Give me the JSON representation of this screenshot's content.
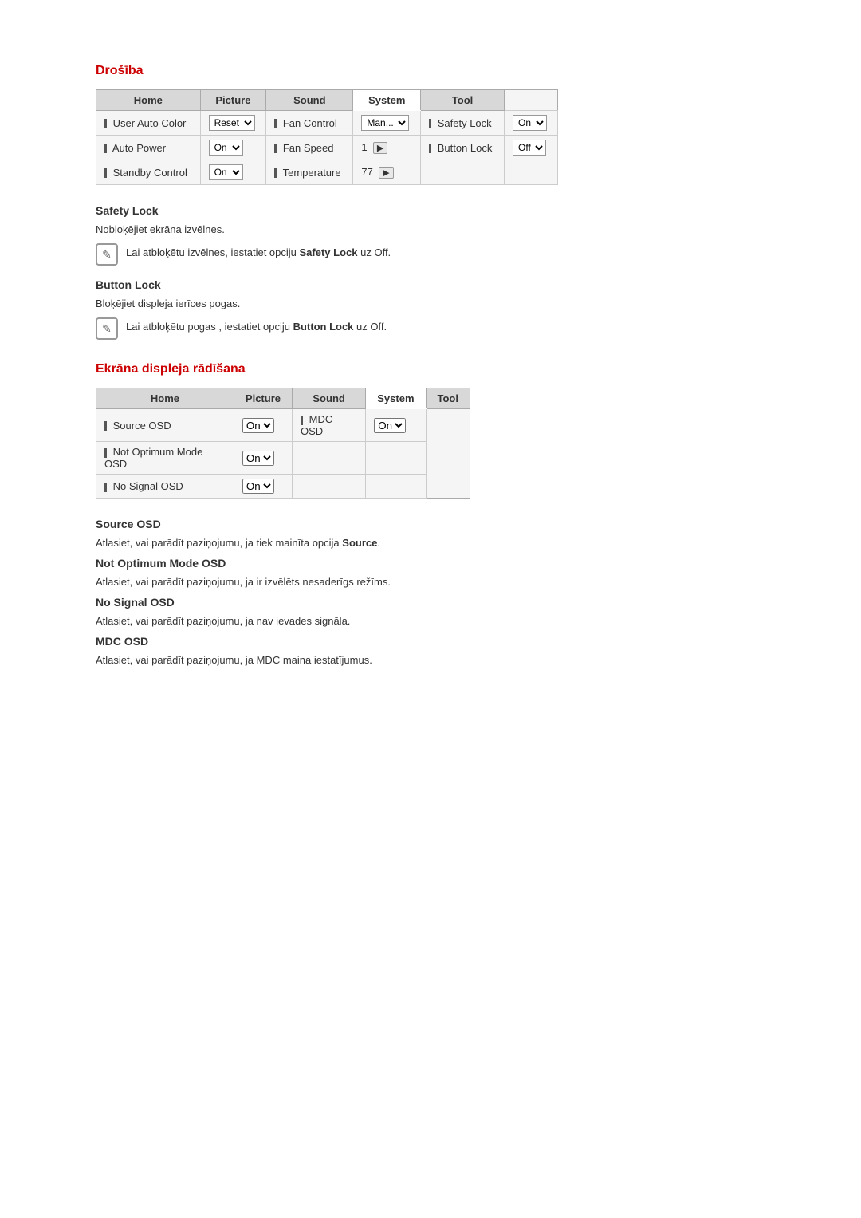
{
  "section1": {
    "title": "Drošība",
    "tabs": [
      "Home",
      "Picture",
      "Sound",
      "System",
      "Tool"
    ],
    "active_tab": "System",
    "rows": [
      {
        "col1_label": "User Auto Color",
        "col2_label": "Reset",
        "col2_type": "dropdown",
        "col3_label": "Fan Control",
        "col4_label": "Man...",
        "col4_type": "dropdown",
        "col5_label": "Safety Lock",
        "col6_label": "On",
        "col6_type": "dropdown"
      },
      {
        "col1_label": "Auto Power",
        "col2_label": "On",
        "col2_type": "dropdown",
        "col3_label": "Fan Speed",
        "col4_label": "1",
        "col4_type": "arrow",
        "col5_label": "Button Lock",
        "col6_label": "Off",
        "col6_type": "dropdown"
      },
      {
        "col1_label": "Standby Control",
        "col2_label": "On",
        "col2_type": "dropdown",
        "col3_label": "Temperature",
        "col4_label": "77",
        "col4_type": "arrow",
        "col5_label": "",
        "col6_label": "",
        "col6_type": ""
      }
    ],
    "safety_lock": {
      "heading": "Safety Lock",
      "desc": "Nobloķējiet ekrāna izvēlnes.",
      "note": "Lai atbloķētu izvēlnes, iestatiet opciju ",
      "note_bold": "Safety Lock",
      "note_suffix": " uz Off."
    },
    "button_lock": {
      "heading": "Button Lock",
      "desc": "Bloķējiet displeja ierīces pogas.",
      "note": "Lai atbloķētu pogas , iestatiet opciju ",
      "note_bold": "Button Lock",
      "note_suffix": " uz Off."
    }
  },
  "section2": {
    "title": "Ekrāna displeja rādīšana",
    "tabs": [
      "Home",
      "Picture",
      "Sound",
      "System",
      "Tool"
    ],
    "active_tab": "System",
    "rows": [
      {
        "col1_label": "Source OSD",
        "col2_label": "On",
        "col2_type": "dropdown",
        "col3_label": "MDC OSD",
        "col4_label": "On",
        "col4_type": "dropdown"
      },
      {
        "col1_label": "Not Optimum Mode OSD",
        "col2_label": "On",
        "col2_type": "dropdown",
        "col3_label": "",
        "col4_label": "",
        "col4_type": ""
      },
      {
        "col1_label": "No Signal OSD",
        "col2_label": "On",
        "col2_type": "dropdown",
        "col3_label": "",
        "col4_label": "",
        "col4_type": ""
      }
    ],
    "source_osd": {
      "heading": "Source OSD",
      "desc": "Atlasiet, vai parādīt paziņojumu, ja tiek mainīta opcija ",
      "desc_bold": "Source",
      "desc_suffix": "."
    },
    "not_optimum": {
      "heading": "Not Optimum Mode OSD",
      "desc": "Atlasiet, vai parādīt paziņojumu, ja ir izvēlēts nesaderīgs režīms."
    },
    "no_signal": {
      "heading": "No Signal OSD",
      "desc": "Atlasiet, vai parādīt paziņojumu, ja nav ievades signāla."
    },
    "mdc_osd": {
      "heading": "MDC OSD",
      "desc": "Atlasiet, vai parādīt paziņojumu, ja MDC maina iestatījumus."
    }
  },
  "icons": {
    "note": "✎",
    "arrow_right": "▶"
  }
}
